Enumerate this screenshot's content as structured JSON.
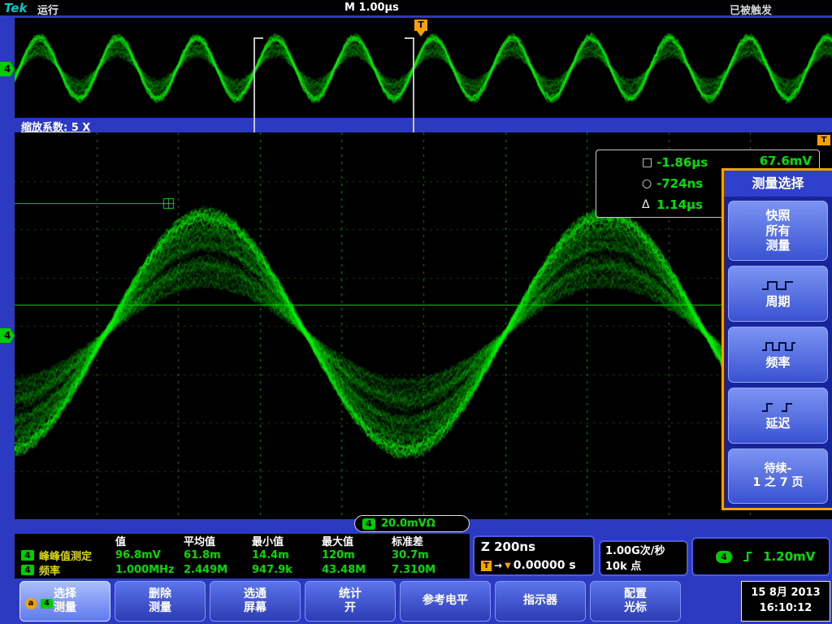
{
  "colors": {
    "frame_blue": "#2b3ac0",
    "button_blue": "#3a52d2",
    "accent_orange": "#f5a100",
    "waveform_green": "#00ff00",
    "value_green": "#00e000",
    "tek_teal": "#00c9c9"
  },
  "top_bar": {
    "logo": "Tek",
    "run_status": "运行",
    "timebase": "M 1.00µs",
    "trigger_status": "已被触发"
  },
  "zoom_bar": {
    "label": "缩放系数: 5 X"
  },
  "upper_strip": {
    "channel_badge": "4",
    "trigger_flag": "T"
  },
  "grid": {
    "channel_badge": "4",
    "trigger_corner": "T"
  },
  "cursor_readout": {
    "cursor1_symbol": "□",
    "cursor1_value": "-1.86µs",
    "cursor2_symbol": "○",
    "cursor2_value": "-724ns",
    "delta_symbol": "Δ",
    "delta_value": "1.14µs",
    "level_value": "67.6mV"
  },
  "scale_pill": {
    "channel": "4",
    "value": "20.0mVΩ"
  },
  "side_menu": {
    "title": "测量选择",
    "items": [
      {
        "label": "快照\n所有\n测量",
        "icon": "none"
      },
      {
        "label": "周期",
        "icon": "period-waveform-icon"
      },
      {
        "label": "频率",
        "icon": "frequency-waveform-icon"
      },
      {
        "label": "延迟",
        "icon": "delay-edges-icon"
      },
      {
        "label": "待续-\n1 之 7 页",
        "icon": "none"
      }
    ]
  },
  "measurements": {
    "headers": [
      "值",
      "平均值",
      "最小值",
      "最大值",
      "标准差"
    ],
    "rows": [
      {
        "channel": "4",
        "name": "峰峰值测定",
        "value": "96.8mV",
        "mean": "61.8m",
        "min": "14.4m",
        "max": "120m",
        "stddev": "30.7m"
      },
      {
        "channel": "4",
        "name": "频率",
        "value": "1.000MHz",
        "mean": "2.449M",
        "min": "947.9k",
        "max": "43.48M",
        "stddev": "7.310M"
      }
    ]
  },
  "zoom_timebase": {
    "scale": "Z 200ns",
    "trigger_symbol": "T",
    "arrow": "→",
    "marker": "▼",
    "position": "0.00000 s"
  },
  "acquisition": {
    "rate": "1.00G次/秒",
    "points": "10k 点"
  },
  "trigger": {
    "channel": "4",
    "level": "1.20mV"
  },
  "bottom_menu": {
    "items": [
      {
        "label": "选择\n测量",
        "selected": true
      },
      {
        "label": "删除\n测量",
        "selected": false
      },
      {
        "label": "选通\n屏幕",
        "selected": false
      },
      {
        "label": "统计\n开",
        "selected": false
      },
      {
        "label": "参考电平",
        "selected": false
      },
      {
        "label": "指示器",
        "selected": false
      },
      {
        "label": "配置\n光标",
        "selected": false
      }
    ],
    "selected_badges": {
      "a": "a",
      "channel": "4"
    }
  },
  "datetime": {
    "date": "15 8月 2013",
    "time": "16:10:12"
  }
}
